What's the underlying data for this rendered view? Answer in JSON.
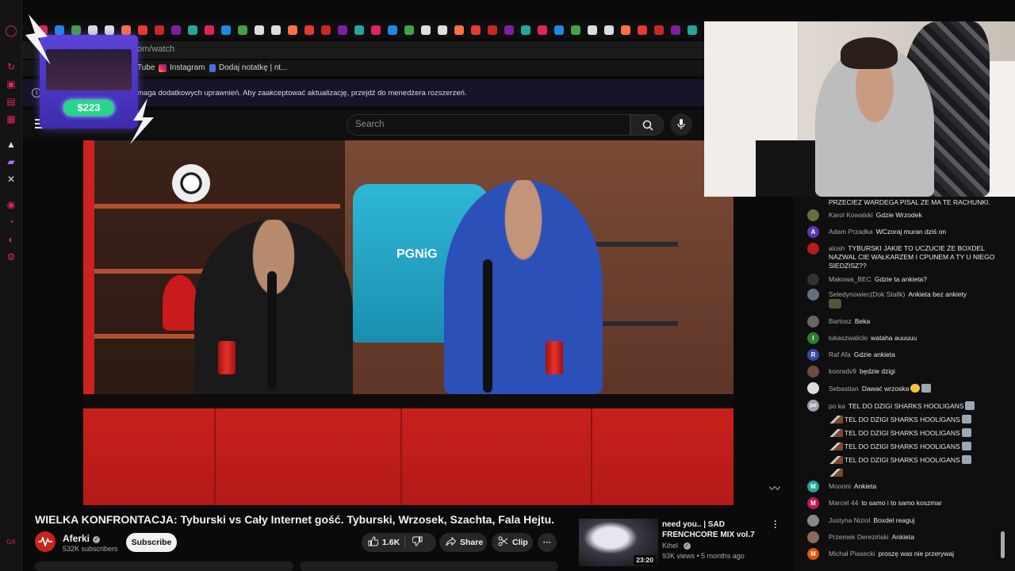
{
  "browser": {
    "address_text": "om/watch",
    "bookmarks": [
      {
        "label": "Tube"
      },
      {
        "label": "Instagram"
      },
      {
        "label": "Dodaj notatkę | nt..."
      }
    ],
    "notice": "maga dodatkowych uprawnień. Aby zaakceptować aktualizację, przejdź do menedżera rozszerzeń."
  },
  "header": {
    "search_placeholder": "Search"
  },
  "video": {
    "title": "WIELKA KONFRONTACJA: Tyburski vs Cały Internet gość. Tyburski, Wrzosek, Szachta, Fala Hejtu.",
    "jersey_text": "PGNiG",
    "channel": {
      "name": "Aferki",
      "subscribers": "532K subscribers"
    },
    "subscribe_label": "Subscribe",
    "like_count": "1.6K",
    "share_label": "Share",
    "clip_label": "Clip"
  },
  "recommendation": {
    "title": "need you.. | SAD FRENCHCORE MIX vol.7",
    "channel": "Kihel",
    "meta": "93K views • 5 months ago",
    "duration": "23:20"
  },
  "donation": {
    "amount": "$223"
  },
  "chat": {
    "messages": [
      {
        "user": "",
        "text": "PRZECIEZ WARDEGA PISAL ZE MA TE RACHUNKI.",
        "avatar": "",
        "color": ""
      },
      {
        "user": "Karol Kowalski",
        "text": "Gdzie Wrzodek",
        "avatar": "",
        "color": "#6b6b40"
      },
      {
        "user": "Adam Przadka",
        "text": "WCzoraj muran dziś on",
        "avatar": "A",
        "color": "#5e35b1"
      },
      {
        "user": "alosh",
        "text": "TYBURSKI JAKIE TO UCZUCIE ŻE BOXDEL NAZWAL CIE WAŁKARZEM I CPUNEM A TY U NIEGO SIEDZISZ??",
        "avatar": "",
        "color": "#b71c1c"
      },
      {
        "user": "Makowa_BEC",
        "text": "Gdzie ta ankieta?",
        "avatar": "",
        "color": "#333"
      },
      {
        "user": "Seledynowiec(Dok Stallk)",
        "text": "Ankieta bez ankiety",
        "avatar": "",
        "color": "#607080"
      },
      {
        "user": "Bartosz",
        "text": "Beka",
        "avatar": "",
        "color": "#666"
      },
      {
        "user": "lukaszwalicki",
        "text": "wataha auuuuu",
        "avatar": "l",
        "color": "#2e7d32"
      },
      {
        "user": "Raf Afa",
        "text": "Gdzie ankieta",
        "avatar": "R",
        "color": "#3949ab"
      },
      {
        "user": "konradv9",
        "text": "będzie dzigi",
        "avatar": "",
        "color": "#6d4c41"
      },
      {
        "user": "Sebastian",
        "text": "Dawać wrzoska",
        "avatar": "",
        "color": "#ddd"
      },
      {
        "user": "po ka",
        "text": "TEL DO DZIGI SHARKS HOOLIGANS",
        "avatar": "po",
        "color": "#9aa0b0"
      },
      {
        "user": "",
        "text": "TEL DO DZIGI SHARKS HOOLIGANS",
        "avatar": "",
        "color": ""
      },
      {
        "user": "",
        "text": "TEL DO DZIGI SHARKS HOOLIGANS",
        "avatar": "",
        "color": ""
      },
      {
        "user": "",
        "text": "TEL DO DZIGI SHARKS HOOLIGANS",
        "avatar": "",
        "color": ""
      },
      {
        "user": "",
        "text": "TEL DO DZIGI SHARKS HOOLIGANS",
        "avatar": "",
        "color": ""
      },
      {
        "user": "Moooni",
        "text": "Ankieta",
        "avatar": "M",
        "color": "#26a69a"
      },
      {
        "user": "Marcel 44",
        "text": "to samo i to samo koszmar",
        "avatar": "M",
        "color": "#c2185b"
      },
      {
        "user": "Justyna Niziol",
        "text": "Boxdel reaguj",
        "avatar": "",
        "color": "#888"
      },
      {
        "user": "Przemek Dereziński",
        "text": "Ankieta",
        "avatar": "",
        "color": "#8a6a5a"
      },
      {
        "user": "Michał Piasecki",
        "text": "proszę was nie przerywaj",
        "avatar": "M",
        "color": "#e65100"
      }
    ]
  },
  "colors": {
    "youtube_red": "#ff0000",
    "subscribe_bg": "#f1f1f1",
    "donation_green": "#28d48a",
    "donation_purple": "#5b42d8"
  }
}
